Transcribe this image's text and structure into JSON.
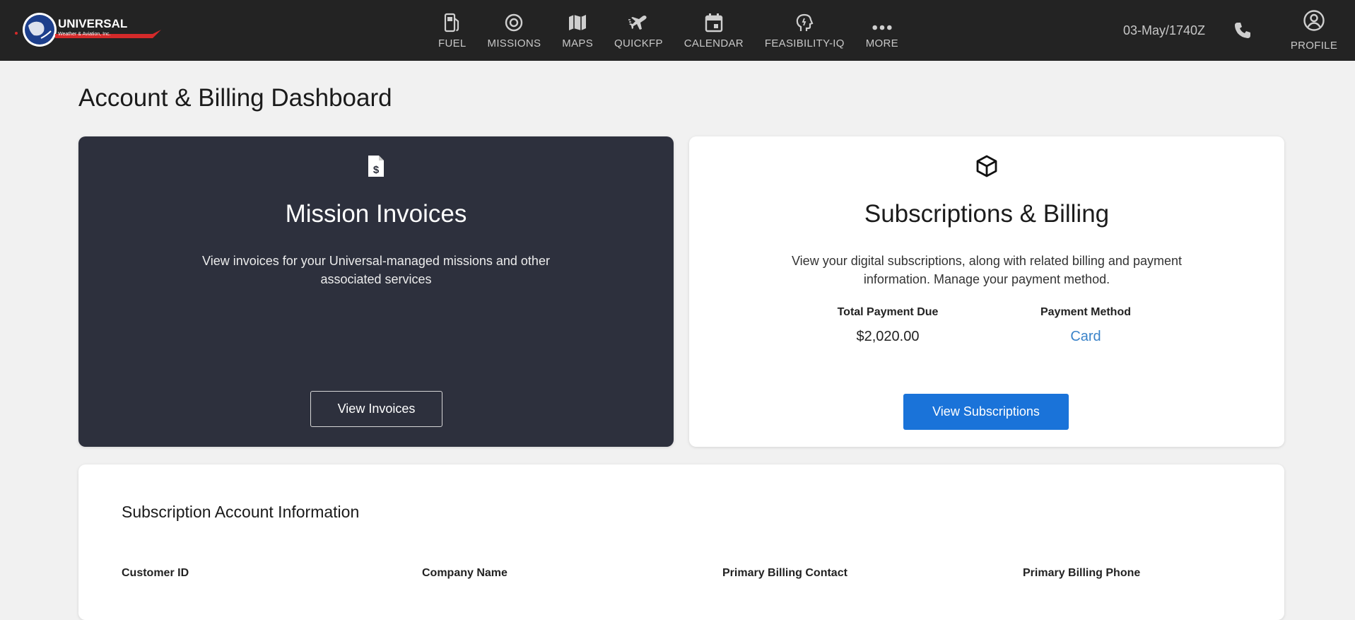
{
  "brand": {
    "name": "UNIVERSAL",
    "tagline": "Weather & Aviation, Inc."
  },
  "nav": [
    {
      "id": "fuel",
      "label": "FUEL",
      "icon": "fuel-pump-icon"
    },
    {
      "id": "missions",
      "label": "MISSIONS",
      "icon": "target-icon"
    },
    {
      "id": "maps",
      "label": "MAPS",
      "icon": "map-icon"
    },
    {
      "id": "quickfp",
      "label": "QUICKFP",
      "icon": "fast-plane-icon"
    },
    {
      "id": "calendar",
      "label": "CALENDAR",
      "icon": "calendar-icon"
    },
    {
      "id": "feasibility",
      "label": "FEASIBILITY-IQ",
      "icon": "head-idea-icon"
    },
    {
      "id": "more",
      "label": "MORE",
      "icon": "more-dots-icon"
    }
  ],
  "header": {
    "datetime": "03-May/1740Z",
    "profile_label": "PROFILE"
  },
  "page": {
    "title": "Account & Billing Dashboard"
  },
  "invoices_card": {
    "title": "Mission Invoices",
    "description": "View invoices for your Universal-managed missions and other associated services",
    "button_label": "View Invoices"
  },
  "subscriptions_card": {
    "title": "Subscriptions & Billing",
    "description": "View your digital subscriptions, along with related billing and payment information. Manage your payment method.",
    "total_due_label": "Total Payment Due",
    "total_due_value": "$2,020.00",
    "payment_method_label": "Payment Method",
    "payment_method_value": "Card",
    "button_label": "View Subscriptions"
  },
  "account_info": {
    "title": "Subscription Account Information",
    "columns": [
      "Customer ID",
      "Company Name",
      "Primary Billing Contact",
      "Primary Billing Phone"
    ]
  },
  "colors": {
    "topbar": "#232323",
    "dark_card": "#2d303d",
    "primary_button": "#1a73d9",
    "link_value": "#3a83c9",
    "page_bg": "#f1f1f1"
  }
}
